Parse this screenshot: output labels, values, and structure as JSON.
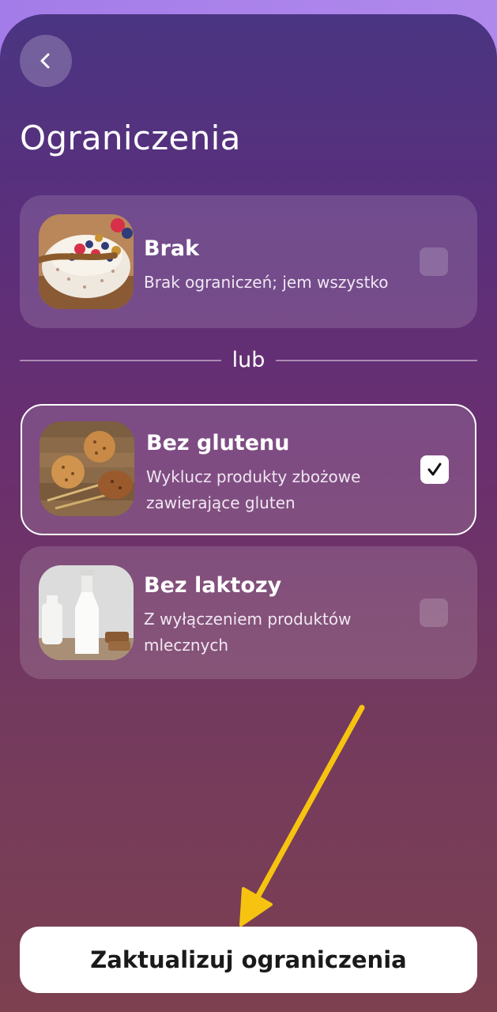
{
  "header": {
    "back_icon": "chevron-left-icon",
    "title": "Ograniczenia"
  },
  "options": [
    {
      "title": "Brak",
      "description": "Brak ograniczeń; jem wszystko",
      "image": "porridge-bowl-berries",
      "checked": false
    },
    {
      "title": "Bez glutenu",
      "description": "Wyklucz produkty zbożowe zawierające gluten",
      "image": "cookies-wheat",
      "checked": true
    },
    {
      "title": "Bez laktozy",
      "description": "Z wyłączeniem produktów mlecznych",
      "image": "milk-bottles",
      "checked": false
    }
  ],
  "separator_label": "lub",
  "cta": {
    "label": "Zaktualizuj ograniczenia"
  },
  "colors": {
    "annotation_arrow": "#f6c410",
    "cta_background": "#ffffff"
  }
}
